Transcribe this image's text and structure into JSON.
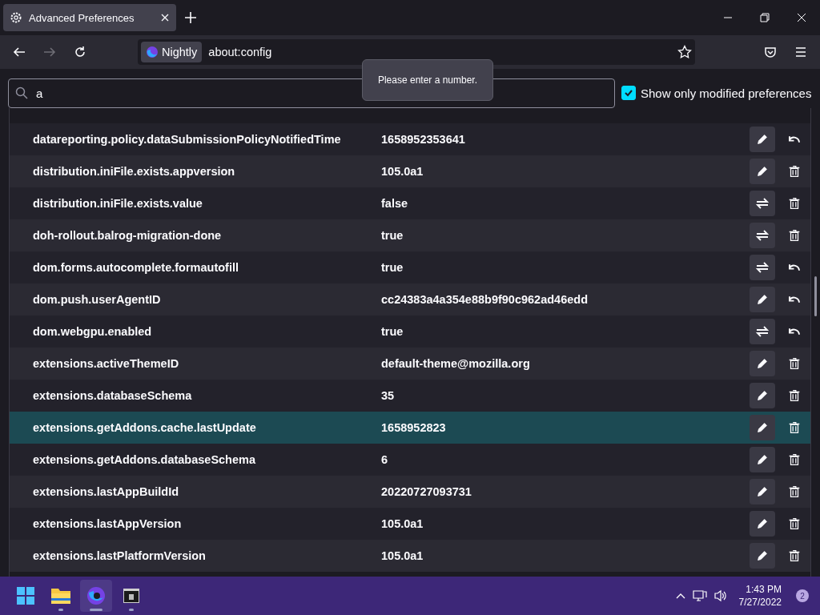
{
  "tab": {
    "title": "Advanced Preferences",
    "selected": true
  },
  "toolbar": {
    "identity": "Nightly",
    "url": "about:config"
  },
  "tooltip": "Please enter a number.",
  "search": {
    "value": "a",
    "show_only_modified": {
      "label": "Show only modified preferences",
      "checked": true
    }
  },
  "rows": [
    {
      "name": "datareporting.policy.dataSubmissionPolicyNotifiedTime",
      "value": "1658952353641",
      "kind": "edit",
      "resettable": true,
      "selected": false
    },
    {
      "name": "distribution.iniFile.exists.appversion",
      "value": "105.0a1",
      "kind": "edit",
      "resettable": false,
      "selected": false
    },
    {
      "name": "distribution.iniFile.exists.value",
      "value": "false",
      "kind": "toggle",
      "resettable": false,
      "selected": false
    },
    {
      "name": "doh-rollout.balrog-migration-done",
      "value": "true",
      "kind": "toggle",
      "resettable": false,
      "selected": false
    },
    {
      "name": "dom.forms.autocomplete.formautofill",
      "value": "true",
      "kind": "toggle",
      "resettable": true,
      "selected": false
    },
    {
      "name": "dom.push.userAgentID",
      "value": "cc24383a4a354e88b9f90c962ad46edd",
      "kind": "edit",
      "resettable": true,
      "selected": false
    },
    {
      "name": "dom.webgpu.enabled",
      "value": "true",
      "kind": "toggle",
      "resettable": true,
      "selected": false
    },
    {
      "name": "extensions.activeThemeID",
      "value": "default-theme@mozilla.org",
      "kind": "edit",
      "resettable": false,
      "selected": false
    },
    {
      "name": "extensions.databaseSchema",
      "value": "35",
      "kind": "edit",
      "resettable": false,
      "selected": false
    },
    {
      "name": "extensions.getAddons.cache.lastUpdate",
      "value": "1658952823",
      "kind": "edit",
      "resettable": false,
      "selected": true
    },
    {
      "name": "extensions.getAddons.databaseSchema",
      "value": "6",
      "kind": "edit",
      "resettable": false,
      "selected": false
    },
    {
      "name": "extensions.lastAppBuildId",
      "value": "20220727093731",
      "kind": "edit",
      "resettable": false,
      "selected": false
    },
    {
      "name": "extensions.lastAppVersion",
      "value": "105.0a1",
      "kind": "edit",
      "resettable": false,
      "selected": false
    },
    {
      "name": "extensions.lastPlatformVersion",
      "value": "105.0a1",
      "kind": "edit",
      "resettable": false,
      "selected": false
    }
  ],
  "taskbar": {
    "apps": [
      {
        "kind": "start",
        "selected": false
      },
      {
        "kind": "files",
        "selected": false
      },
      {
        "kind": "browser",
        "selected": true
      },
      {
        "kind": "terminal",
        "selected": false
      }
    ],
    "time": "1:43 PM",
    "date": "7/27/2022",
    "notifications": "2"
  }
}
